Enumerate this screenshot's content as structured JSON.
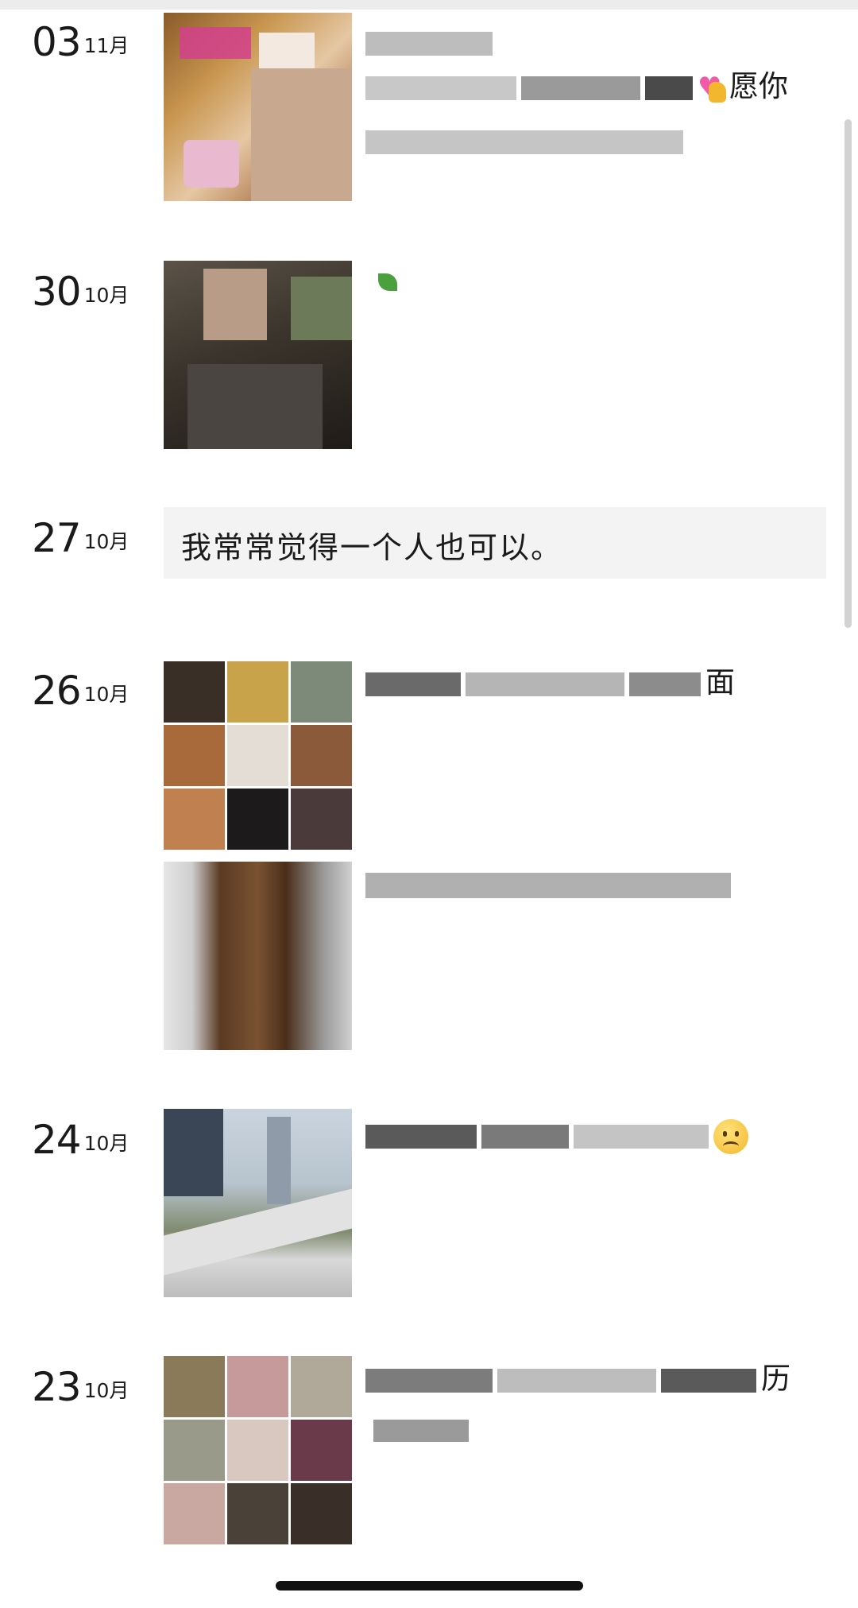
{
  "entries": [
    {
      "day": "03",
      "month": "11月",
      "caption_tail": "愿你"
    },
    {
      "day": "30",
      "month": "10月"
    },
    {
      "day": "27",
      "month": "10月",
      "text": "我常常觉得一个人也可以。"
    },
    {
      "day": "26",
      "month": "10月",
      "caption_tail": "面"
    },
    {
      "day": "24",
      "month": "10月"
    },
    {
      "day": "23",
      "month": "10月",
      "caption_tail": "历"
    }
  ],
  "icons": {
    "emoji_heart": "heart-emoji",
    "emoji_sad": "sad-face-emoji",
    "emoji_leaf": "leaf-emoji"
  }
}
